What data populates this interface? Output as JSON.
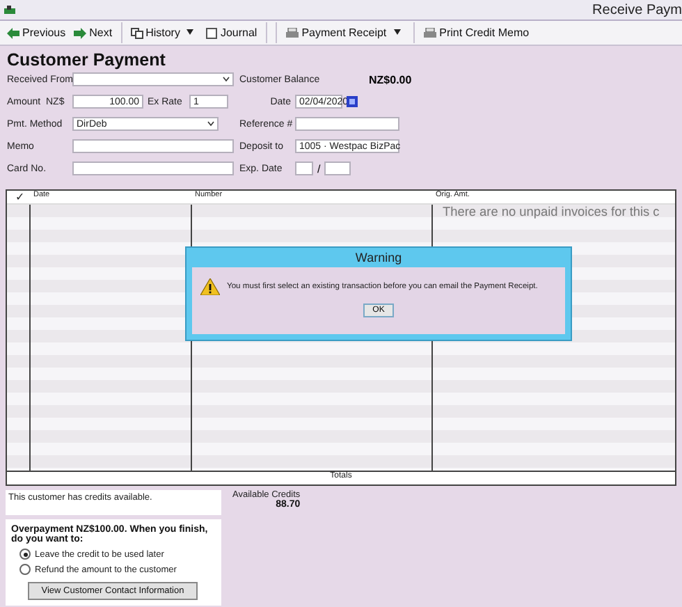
{
  "window": {
    "title": "Receive Paym"
  },
  "toolbar": [
    {
      "label": "Previous",
      "kind": "previous",
      "dropdown": false
    },
    {
      "label": "Next",
      "kind": "next",
      "dropdown": false
    },
    {
      "label": "History",
      "kind": "history",
      "dropdown": true
    },
    {
      "label": "Journal",
      "kind": "journal",
      "dropdown": false
    },
    {
      "label": "Payment Receipt",
      "kind": "print",
      "dropdown": true
    },
    {
      "label": "Print Credit Memo",
      "kind": "print",
      "dropdown": false
    }
  ],
  "form": {
    "heading": "Customer Payment",
    "left": [
      {
        "kind": "dropdown",
        "label": "Received From"
      },
      {
        "kind": "amount",
        "label": "Amount",
        "currency": "NZ$",
        "value": "100.00",
        "rate_label": "Ex Rate",
        "rate": "1"
      },
      {
        "kind": "dropdown",
        "label": "Pmt. Method",
        "value": "DirDeb"
      },
      {
        "kind": "text",
        "label": "Memo"
      },
      {
        "kind": "text",
        "label": "Card No."
      }
    ],
    "right": [
      {
        "kind": "readout",
        "label": "Customer Balance",
        "value": "NZ$0.00"
      },
      {
        "kind": "date",
        "label": "Date",
        "value": "02/04/2020"
      },
      {
        "kind": "text",
        "label": "Reference #"
      },
      {
        "kind": "dropdown",
        "label": "Deposit to",
        "value": "1005 · Westpac BizPac"
      },
      {
        "kind": "expiry",
        "label": "Exp. Date",
        "separator": "/"
      }
    ]
  },
  "table": {
    "columns": [
      "✓",
      "Date",
      "Number",
      "Orig. Amt."
    ],
    "empty_message": "There are no unpaid invoices for this c",
    "totals": "Totals"
  },
  "credits": {
    "note": "This customer has credits available.",
    "label": "Available Credits",
    "value": "88.70"
  },
  "overpayment": {
    "text": "Overpayment NZ$100.00. When you finish, do you want to:",
    "options": [
      {
        "label": "Leave the credit to be used later",
        "selected": true
      },
      {
        "label": "Refund the amount to the customer",
        "selected": false
      }
    ],
    "button": "View Customer Contact Information"
  },
  "dialog": {
    "title": "Warning",
    "message": "You must first select an existing transaction before you can email the Payment Receipt.",
    "button": "OK"
  }
}
